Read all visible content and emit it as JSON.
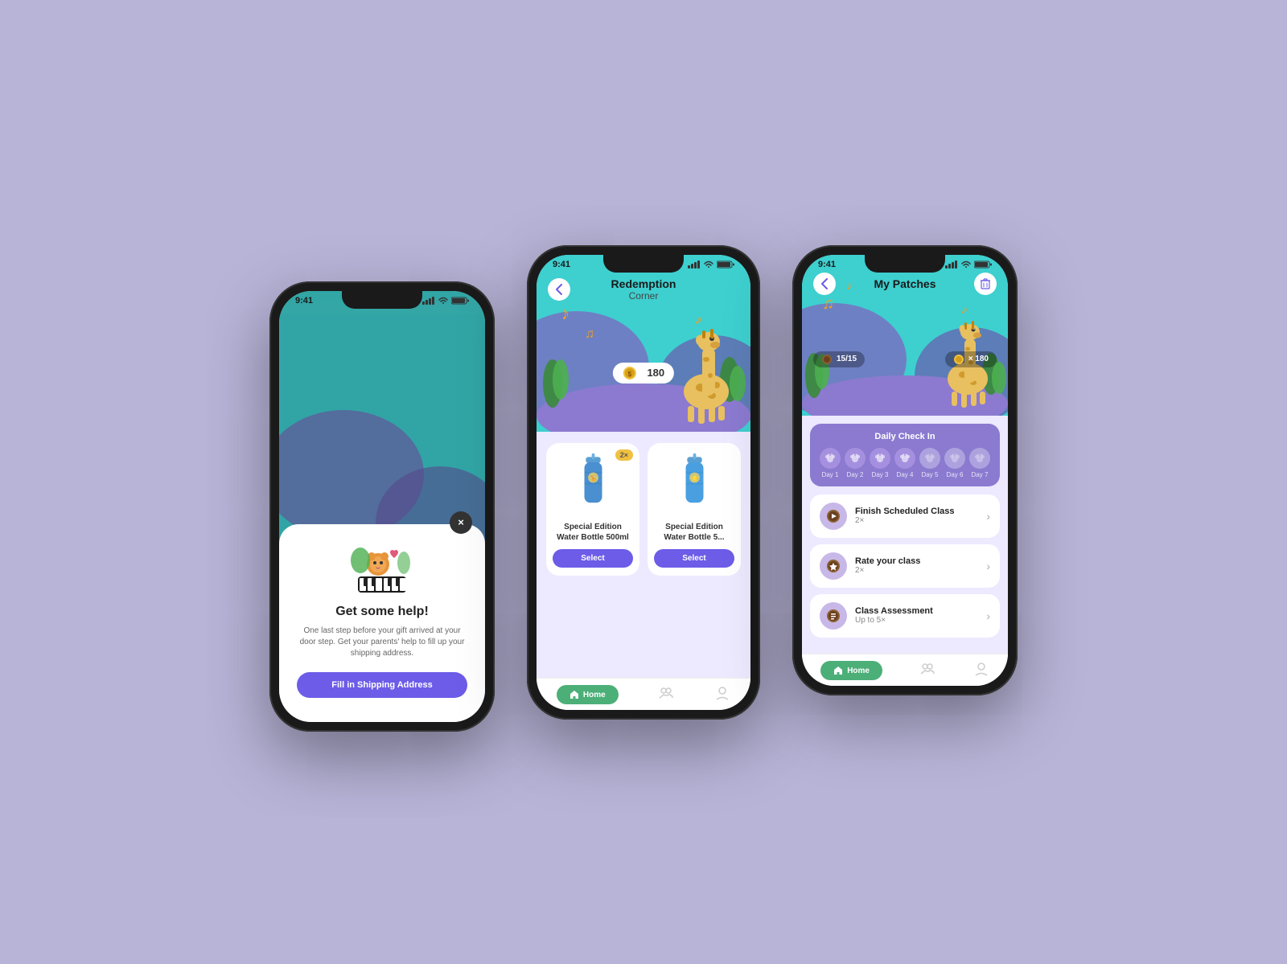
{
  "background": "#b8b4d8",
  "phone1": {
    "statusbar": {
      "time": "9:41"
    },
    "modal": {
      "title": "Get some help!",
      "description": "One last step before your gift arrived at your door step. Get your parents' help to fill up your shipping address.",
      "button_label": "Fill in Shipping Address",
      "close_label": "×"
    }
  },
  "phone2": {
    "statusbar": {
      "time": "9:41"
    },
    "header": {
      "title": "Redemption",
      "subtitle": "Corner",
      "back": "‹"
    },
    "coin_count": "180",
    "products": [
      {
        "name": "Special Edition Water Bottle 500ml",
        "badge": "2×",
        "select_label": "Select"
      },
      {
        "name": "Special Edition Water Bottle 5...",
        "badge": "",
        "select_label": "Select"
      }
    ],
    "nav": {
      "home_label": "Home"
    }
  },
  "phone3": {
    "statusbar": {
      "time": "9:41"
    },
    "header": {
      "title": "My Patches",
      "back": "‹",
      "trash": "🗑"
    },
    "coins1": "15/15",
    "coins2": "× 180",
    "daily_checkin": {
      "title": "Daily Check In",
      "days": [
        "Day 1",
        "Day 2",
        "Day 3",
        "Day 4",
        "Day 5",
        "Day 6",
        "Day 7"
      ]
    },
    "tasks": [
      {
        "name": "Finish Scheduled Class",
        "sub": "2×",
        "icon": "🎵"
      },
      {
        "name": "Rate your class",
        "sub": "2×",
        "icon": "⭐"
      },
      {
        "name": "Class Assessment",
        "sub": "Up to 5×",
        "icon": "📋"
      }
    ],
    "nav": {
      "home_label": "Home"
    }
  }
}
